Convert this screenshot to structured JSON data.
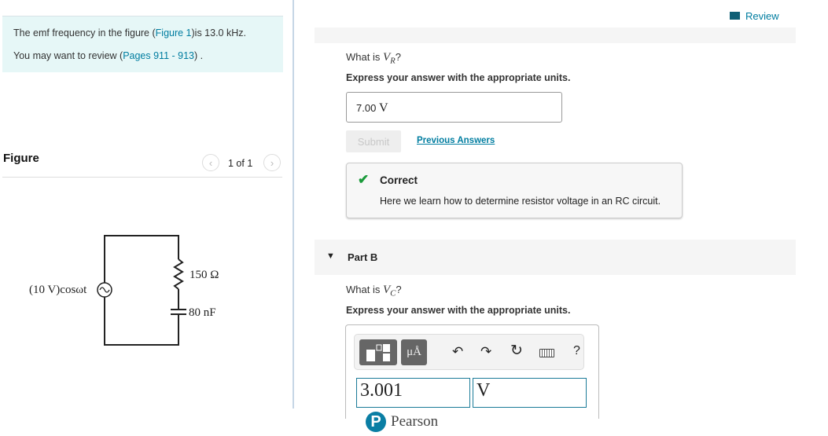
{
  "problem": {
    "line1_pre": "The emf frequency in the figure (",
    "line1_link": "Figure 1",
    "line1_post": ")is 13.0 kHz.",
    "line2_pre": "You may want to review (",
    "line2_link": "Pages 911 - 913",
    "line2_post": ") ."
  },
  "figure": {
    "title": "Figure",
    "pager": "1 of 1",
    "prev_icon": "chevron-left-icon",
    "next_icon": "chevron-right-icon",
    "source_label": "(10 V)cosωt",
    "resistor_label": "150 Ω",
    "capacitor_label": "80 nF"
  },
  "header": {
    "review_label": "Review",
    "review_icon": "book-icon"
  },
  "partA": {
    "question_pre": "What is ",
    "var": "V",
    "sub": "R",
    "question_post": "?",
    "instruction": "Express your answer with the appropriate units.",
    "answer_num": "7.00",
    "answer_unit": "V",
    "submit_label": "Submit",
    "previous_answers": "Previous Answers",
    "feedback_title": "Correct",
    "feedback_text": "Here we learn how to determine resistor voltage in an RC circuit.",
    "check_color": "#1a9a3a"
  },
  "partB": {
    "title": "Part B",
    "question_pre": "What is ",
    "var": "V",
    "sub": "C",
    "question_post": "?",
    "instruction": "Express your answer with the appropriate units.",
    "toolbar": {
      "templates_icon": "templates-icon",
      "units_label": "μÅ",
      "undo_icon": "undo-icon",
      "redo_icon": "redo-icon",
      "reset_icon": "reset-icon",
      "keyboard_icon": "keyboard-icon",
      "help_label": "?"
    },
    "value": "3.001",
    "unit": "V"
  },
  "footer": {
    "brand": "Pearson",
    "brand_color": "#0a7ea4"
  },
  "colors": {
    "accent": "#007da0",
    "info_bg": "#e6f7f7"
  }
}
